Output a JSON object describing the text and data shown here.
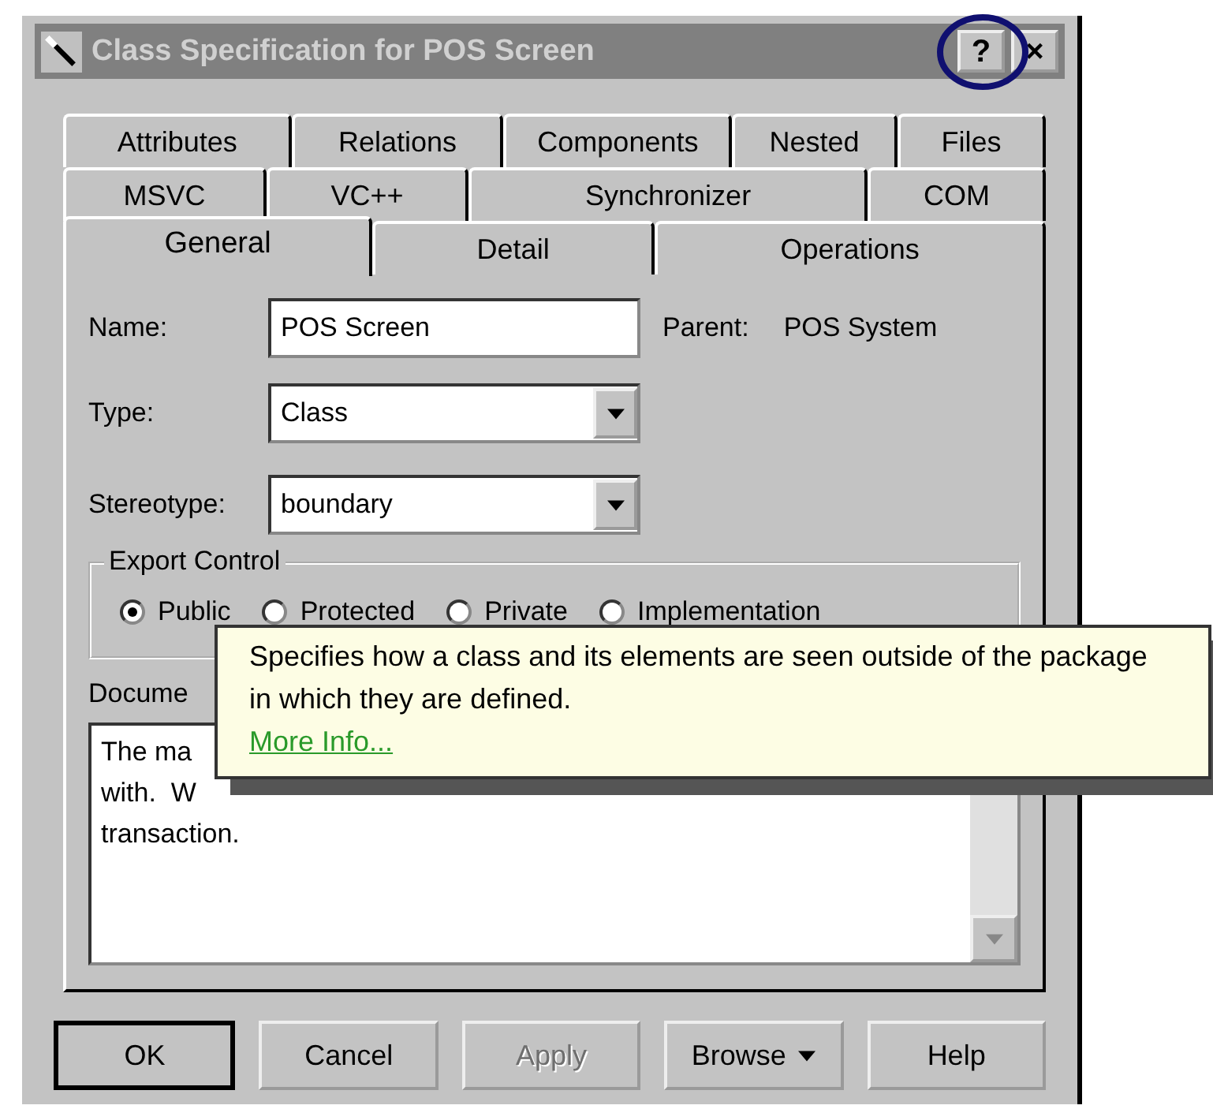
{
  "window": {
    "title": "Class Specification for POS Screen",
    "active": false,
    "help_button": "?",
    "close_button": "×"
  },
  "tabs": [
    [
      {
        "label": "Attributes",
        "selected": false
      },
      {
        "label": "Relations",
        "selected": false
      },
      {
        "label": "Components",
        "selected": false
      },
      {
        "label": "Nested",
        "selected": false
      },
      {
        "label": "Files",
        "selected": false
      }
    ],
    [
      {
        "label": "MSVC",
        "selected": false
      },
      {
        "label": "VC++",
        "selected": false
      },
      {
        "label": "Synchronizer",
        "selected": false
      },
      {
        "label": "COM",
        "selected": false
      }
    ],
    [
      {
        "label": "General",
        "selected": true
      },
      {
        "label": "Detail",
        "selected": false
      },
      {
        "label": "Operations",
        "selected": false
      }
    ]
  ],
  "name": {
    "label": "Name:",
    "value": "POS Screen"
  },
  "parent": {
    "label": "Parent:",
    "value": "POS System"
  },
  "type": {
    "label": "Type:",
    "value": "Class"
  },
  "stereotype": {
    "label": "Stereotype:",
    "value": "boundary"
  },
  "export_control": {
    "title": "Export Control",
    "options": [
      {
        "label": "Public",
        "selected": true
      },
      {
        "label": "Protected",
        "selected": false
      },
      {
        "label": "Private",
        "selected": false
      },
      {
        "label": "Implementation",
        "selected": false
      }
    ]
  },
  "documentation": {
    "label": "Docume",
    "lines": [
      "The ma",
      "with.  W",
      "transaction."
    ]
  },
  "tooltip": {
    "text": "Specifies how a class and its elements are seen outside of the package in which they are defined.",
    "link": "More Info..."
  },
  "buttons": [
    {
      "label": "OK",
      "kind": "default",
      "disabled": false
    },
    {
      "label": "Cancel",
      "kind": "plain",
      "disabled": false
    },
    {
      "label": "Apply",
      "kind": "plain",
      "disabled": true
    },
    {
      "label": "Browse",
      "kind": "menu",
      "disabled": false
    },
    {
      "label": "Help",
      "kind": "plain",
      "disabled": false
    }
  ]
}
